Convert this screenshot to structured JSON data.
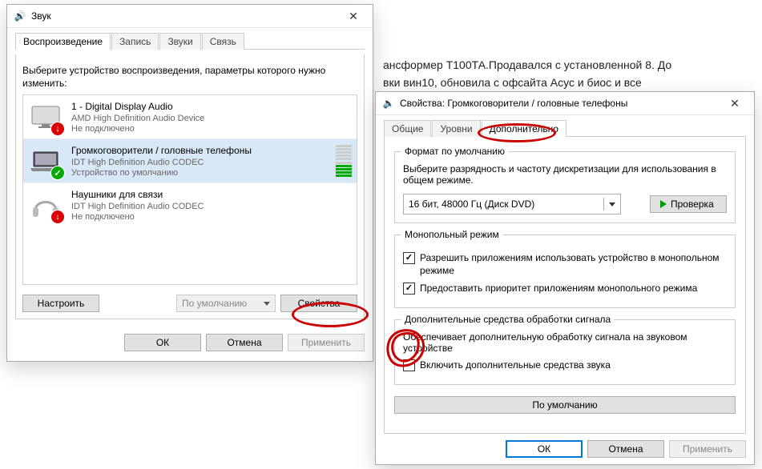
{
  "background_text_line1": "ансформер Т100ТА.Продавался с установленной 8. До",
  "background_text_line2": "вки вин10, обновила с офсайта Асус и биос и все",
  "win1": {
    "title": "Звук",
    "tabs": [
      "Воспроизведение",
      "Запись",
      "Звуки",
      "Связь"
    ],
    "instruction": "Выберите устройство воспроизведения, параметры которого нужно изменить:",
    "devices": [
      {
        "name": "1 - Digital Display Audio",
        "sub": "AMD High Definition Audio Device",
        "status": "Не подключено",
        "badge": "down"
      },
      {
        "name": "Громкоговорители / головные телефоны",
        "sub": "IDT High Definition Audio CODEC",
        "status": "Устройство по умолчанию",
        "badge": "check",
        "selected": true,
        "meter": true
      },
      {
        "name": "Наушники для связи",
        "sub": "IDT High Definition Audio CODEC",
        "status": "Не подключено",
        "badge": "down"
      }
    ],
    "btn_configure": "Настроить",
    "btn_default": "По умолчанию",
    "btn_properties": "Свойства",
    "btn_ok": "ОК",
    "btn_cancel": "Отмена",
    "btn_apply": "Применить"
  },
  "win2": {
    "title": "Свойства: Громкоговорители / головные телефоны",
    "tabs": [
      "Общие",
      "Уровни",
      "Дополнительно"
    ],
    "group_default_format": {
      "legend": "Формат по умолчанию",
      "hint": "Выберите разрядность и частоту дискретизации для использования в общем режиме.",
      "select_value": "16 бит, 48000 Гц (Диск DVD)",
      "btn_test": "Проверка"
    },
    "group_exclusive": {
      "legend": "Монопольный режим",
      "chk_allow": "Разрешить приложениям использовать устройство в монопольном режиме",
      "chk_priority": "Предоставить приоритет приложениям монопольного режима"
    },
    "group_enhance": {
      "legend": "Дополнительные средства обработки сигнала",
      "hint": "Обеспечивает дополнительную обработку сигнала на звуковом устройстве",
      "chk_enable": "Включить дополнительные средства звука"
    },
    "btn_restore": "По умолчанию",
    "btn_ok": "ОК",
    "btn_cancel": "Отмена",
    "btn_apply": "Применить"
  }
}
